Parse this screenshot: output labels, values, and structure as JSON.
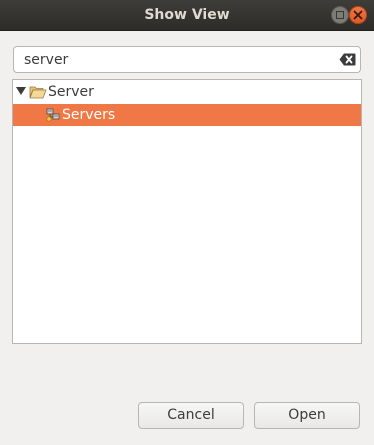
{
  "window": {
    "title": "Show View"
  },
  "search": {
    "value": "server",
    "placeholder": ""
  },
  "tree": {
    "category": {
      "label": "Server",
      "expanded": true,
      "icon": "folder-open-icon"
    },
    "items": [
      {
        "label": "Servers",
        "icon": "servers-icon",
        "selected": true
      }
    ]
  },
  "buttons": {
    "cancel": "Cancel",
    "open": "Open"
  },
  "colors": {
    "titlebar": "#3c3b37",
    "selection": "#f07746",
    "close_button": "#e95420",
    "background": "#f1f0ef"
  }
}
